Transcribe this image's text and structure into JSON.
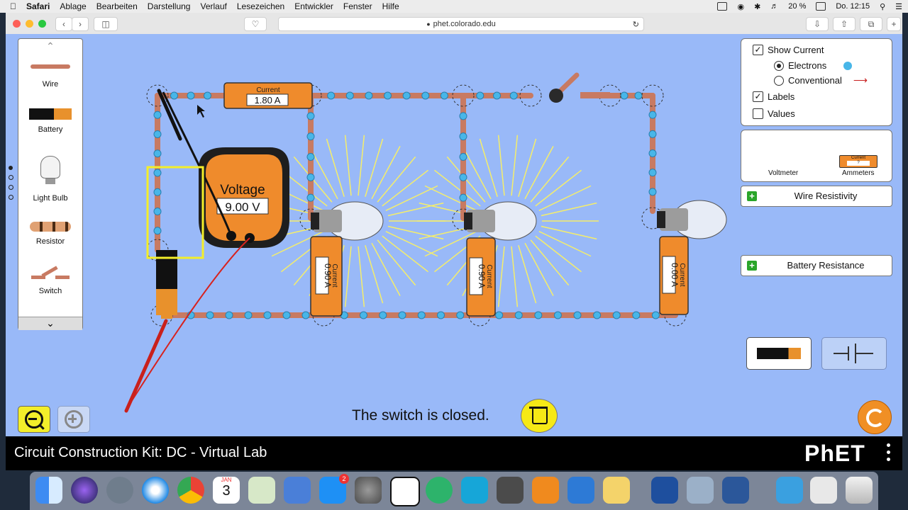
{
  "menubar": {
    "items": [
      "Safari",
      "Ablage",
      "Bearbeiten",
      "Darstellung",
      "Verlauf",
      "Lesezeichen",
      "Entwickler",
      "Fenster",
      "Hilfe"
    ],
    "battery": "20 %",
    "clock": "Do. 12:15"
  },
  "browser": {
    "url": "phet.colorado.edu"
  },
  "palette": {
    "items": [
      {
        "label": "Wire"
      },
      {
        "label": "Battery"
      },
      {
        "label": "Light Bulb"
      },
      {
        "label": "Resistor"
      },
      {
        "label": "Switch"
      }
    ]
  },
  "view_options": {
    "show_current": "Show Current",
    "electrons": "Electrons",
    "conventional": "Conventional",
    "labels": "Labels",
    "values": "Values",
    "show_current_checked": true,
    "electrons_selected": true,
    "labels_checked": true,
    "values_checked": false
  },
  "tools": {
    "voltmeter": "Voltmeter",
    "ammeters": "Ammeters",
    "ammeter_icon_title": "Current",
    "ammeter_icon_value": "?"
  },
  "accordions": {
    "wire_resistivity": "Wire Resistivity",
    "battery_resistance": "Battery Resistance"
  },
  "circuit": {
    "main_ammeter": {
      "title": "Current",
      "value": "1.80 A"
    },
    "branch_ammeters": [
      {
        "title": "Current",
        "value": "0.90 A"
      },
      {
        "title": "Current",
        "value": "0.90 A"
      },
      {
        "title": "Current",
        "value": "0.00 A"
      }
    ],
    "voltmeter": {
      "title": "Voltage",
      "value": "9.00 V"
    }
  },
  "status": "The switch is closed.",
  "footer": {
    "title": "Circuit Construction Kit: DC - Virtual Lab",
    "logo": "PhET"
  },
  "colors": {
    "sim_background": "#99b9f8",
    "wire": "#c87a62",
    "electron": "#48b6e8",
    "meter_orange": "#ef8b2c",
    "highlight": "#f3ee2a"
  },
  "dock": {
    "calendar_month": "JAN",
    "calendar_day": "3",
    "appstore_badge": "2"
  }
}
